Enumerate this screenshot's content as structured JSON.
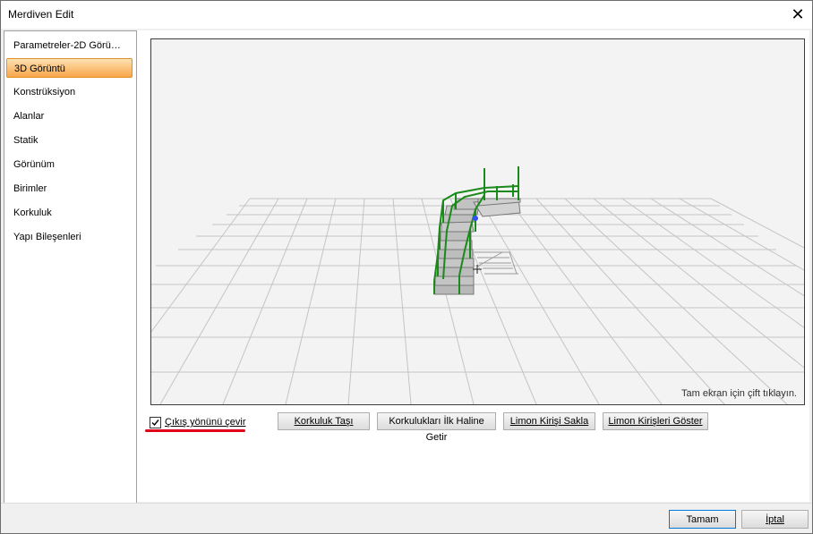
{
  "window": {
    "title": "Merdiven Edit",
    "close_symbol": "✕"
  },
  "sidebar": {
    "items": [
      {
        "label": "Parametreler-2D Görü…"
      },
      {
        "label": "3D Görüntü"
      },
      {
        "label": "Konstrüksiyon"
      },
      {
        "label": "Alanlar"
      },
      {
        "label": "Statik"
      },
      {
        "label": "Görünüm"
      },
      {
        "label": "Birimler"
      },
      {
        "label": "Korkuluk"
      },
      {
        "label": "Yapı Bileşenleri"
      }
    ],
    "active_index": 1
  },
  "viewport": {
    "hint": "Tam ekran için çift tıklayın.",
    "stair_color": "#1a8a1a"
  },
  "options": {
    "flip_exit_label": "Çıkış yönünü çevir",
    "flip_exit_checked": true
  },
  "toolbar": {
    "move_railing": "Korkuluk Taşı",
    "reset_railings": "Korkulukları İlk Haline Getir",
    "hide_stringer": "Limon Kirişi Sakla",
    "show_stringers": "Limon Kirişleri Göster"
  },
  "footer": {
    "ok": "Tamam",
    "cancel": "İptal"
  },
  "colors": {
    "accent": "#f9a64a",
    "highlight_underline": "#e0001a",
    "default_button_border": "#0078d7"
  }
}
